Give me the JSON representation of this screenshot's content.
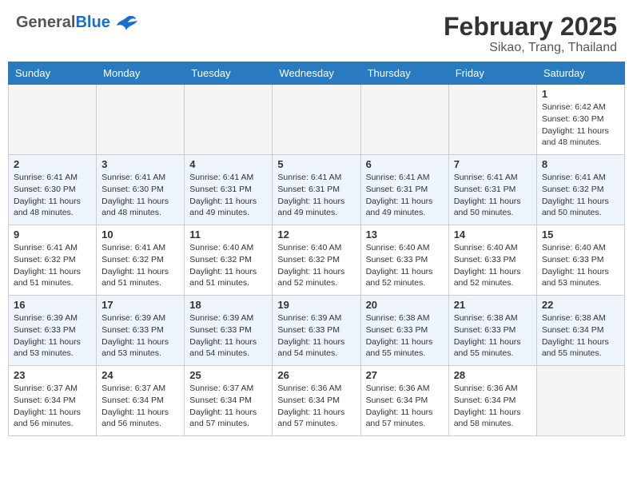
{
  "header": {
    "logo_general": "General",
    "logo_blue": "Blue",
    "month_title": "February 2025",
    "location": "Sikao, Trang, Thailand"
  },
  "weekdays": [
    "Sunday",
    "Monday",
    "Tuesday",
    "Wednesday",
    "Thursday",
    "Friday",
    "Saturday"
  ],
  "weeks": [
    {
      "alt": false,
      "days": [
        {
          "day": "",
          "empty": true
        },
        {
          "day": "",
          "empty": true
        },
        {
          "day": "",
          "empty": true
        },
        {
          "day": "",
          "empty": true
        },
        {
          "day": "",
          "empty": true
        },
        {
          "day": "",
          "empty": true
        },
        {
          "day": "1",
          "empty": false,
          "sunrise": "6:42 AM",
          "sunset": "6:30 PM",
          "daylight": "11 hours and 48 minutes."
        }
      ]
    },
    {
      "alt": true,
      "days": [
        {
          "day": "2",
          "empty": false,
          "sunrise": "6:41 AM",
          "sunset": "6:30 PM",
          "daylight": "11 hours and 48 minutes."
        },
        {
          "day": "3",
          "empty": false,
          "sunrise": "6:41 AM",
          "sunset": "6:30 PM",
          "daylight": "11 hours and 48 minutes."
        },
        {
          "day": "4",
          "empty": false,
          "sunrise": "6:41 AM",
          "sunset": "6:31 PM",
          "daylight": "11 hours and 49 minutes."
        },
        {
          "day": "5",
          "empty": false,
          "sunrise": "6:41 AM",
          "sunset": "6:31 PM",
          "daylight": "11 hours and 49 minutes."
        },
        {
          "day": "6",
          "empty": false,
          "sunrise": "6:41 AM",
          "sunset": "6:31 PM",
          "daylight": "11 hours and 49 minutes."
        },
        {
          "day": "7",
          "empty": false,
          "sunrise": "6:41 AM",
          "sunset": "6:31 PM",
          "daylight": "11 hours and 50 minutes."
        },
        {
          "day": "8",
          "empty": false,
          "sunrise": "6:41 AM",
          "sunset": "6:32 PM",
          "daylight": "11 hours and 50 minutes."
        }
      ]
    },
    {
      "alt": false,
      "days": [
        {
          "day": "9",
          "empty": false,
          "sunrise": "6:41 AM",
          "sunset": "6:32 PM",
          "daylight": "11 hours and 51 minutes."
        },
        {
          "day": "10",
          "empty": false,
          "sunrise": "6:41 AM",
          "sunset": "6:32 PM",
          "daylight": "11 hours and 51 minutes."
        },
        {
          "day": "11",
          "empty": false,
          "sunrise": "6:40 AM",
          "sunset": "6:32 PM",
          "daylight": "11 hours and 51 minutes."
        },
        {
          "day": "12",
          "empty": false,
          "sunrise": "6:40 AM",
          "sunset": "6:32 PM",
          "daylight": "11 hours and 52 minutes."
        },
        {
          "day": "13",
          "empty": false,
          "sunrise": "6:40 AM",
          "sunset": "6:33 PM",
          "daylight": "11 hours and 52 minutes."
        },
        {
          "day": "14",
          "empty": false,
          "sunrise": "6:40 AM",
          "sunset": "6:33 PM",
          "daylight": "11 hours and 52 minutes."
        },
        {
          "day": "15",
          "empty": false,
          "sunrise": "6:40 AM",
          "sunset": "6:33 PM",
          "daylight": "11 hours and 53 minutes."
        }
      ]
    },
    {
      "alt": true,
      "days": [
        {
          "day": "16",
          "empty": false,
          "sunrise": "6:39 AM",
          "sunset": "6:33 PM",
          "daylight": "11 hours and 53 minutes."
        },
        {
          "day": "17",
          "empty": false,
          "sunrise": "6:39 AM",
          "sunset": "6:33 PM",
          "daylight": "11 hours and 53 minutes."
        },
        {
          "day": "18",
          "empty": false,
          "sunrise": "6:39 AM",
          "sunset": "6:33 PM",
          "daylight": "11 hours and 54 minutes."
        },
        {
          "day": "19",
          "empty": false,
          "sunrise": "6:39 AM",
          "sunset": "6:33 PM",
          "daylight": "11 hours and 54 minutes."
        },
        {
          "day": "20",
          "empty": false,
          "sunrise": "6:38 AM",
          "sunset": "6:33 PM",
          "daylight": "11 hours and 55 minutes."
        },
        {
          "day": "21",
          "empty": false,
          "sunrise": "6:38 AM",
          "sunset": "6:33 PM",
          "daylight": "11 hours and 55 minutes."
        },
        {
          "day": "22",
          "empty": false,
          "sunrise": "6:38 AM",
          "sunset": "6:34 PM",
          "daylight": "11 hours and 55 minutes."
        }
      ]
    },
    {
      "alt": false,
      "days": [
        {
          "day": "23",
          "empty": false,
          "sunrise": "6:37 AM",
          "sunset": "6:34 PM",
          "daylight": "11 hours and 56 minutes."
        },
        {
          "day": "24",
          "empty": false,
          "sunrise": "6:37 AM",
          "sunset": "6:34 PM",
          "daylight": "11 hours and 56 minutes."
        },
        {
          "day": "25",
          "empty": false,
          "sunrise": "6:37 AM",
          "sunset": "6:34 PM",
          "daylight": "11 hours and 57 minutes."
        },
        {
          "day": "26",
          "empty": false,
          "sunrise": "6:36 AM",
          "sunset": "6:34 PM",
          "daylight": "11 hours and 57 minutes."
        },
        {
          "day": "27",
          "empty": false,
          "sunrise": "6:36 AM",
          "sunset": "6:34 PM",
          "daylight": "11 hours and 57 minutes."
        },
        {
          "day": "28",
          "empty": false,
          "sunrise": "6:36 AM",
          "sunset": "6:34 PM",
          "daylight": "11 hours and 58 minutes."
        },
        {
          "day": "",
          "empty": true
        }
      ]
    }
  ]
}
